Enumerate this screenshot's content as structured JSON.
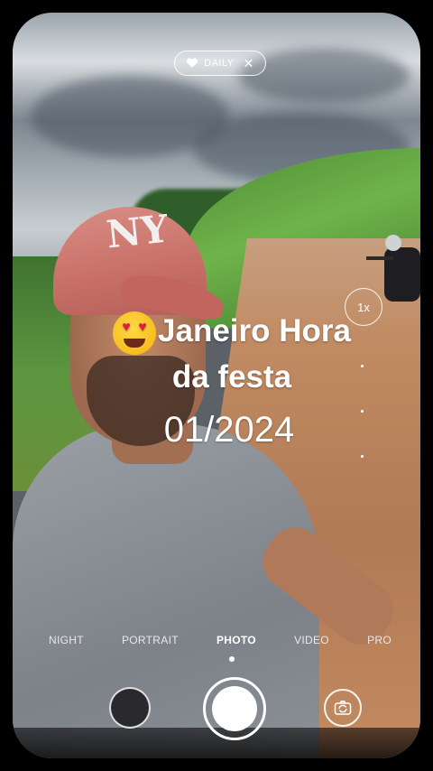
{
  "badge": {
    "label": "DAILY",
    "heart_icon": "heart-icon",
    "close_icon": "close-icon"
  },
  "zoom": {
    "label": "1x"
  },
  "overlay_text": {
    "line1": "Janeiro Hora",
    "line2": "da festa",
    "date": "01/2024",
    "emoji_icon": "heart-eyes-emoji"
  },
  "modes": [
    {
      "label": "NIGHT"
    },
    {
      "label": "PORTRAIT"
    },
    {
      "label": "PHOTO",
      "active": true
    },
    {
      "label": "VIDEO"
    },
    {
      "label": "PRO"
    }
  ],
  "controls": {
    "gallery_icon": "gallery-thumbnail",
    "shutter_icon": "shutter-button",
    "flip_icon": "camera-flip-icon"
  },
  "colors": {
    "text": "#ffffff",
    "shutter": "#ffffff"
  }
}
